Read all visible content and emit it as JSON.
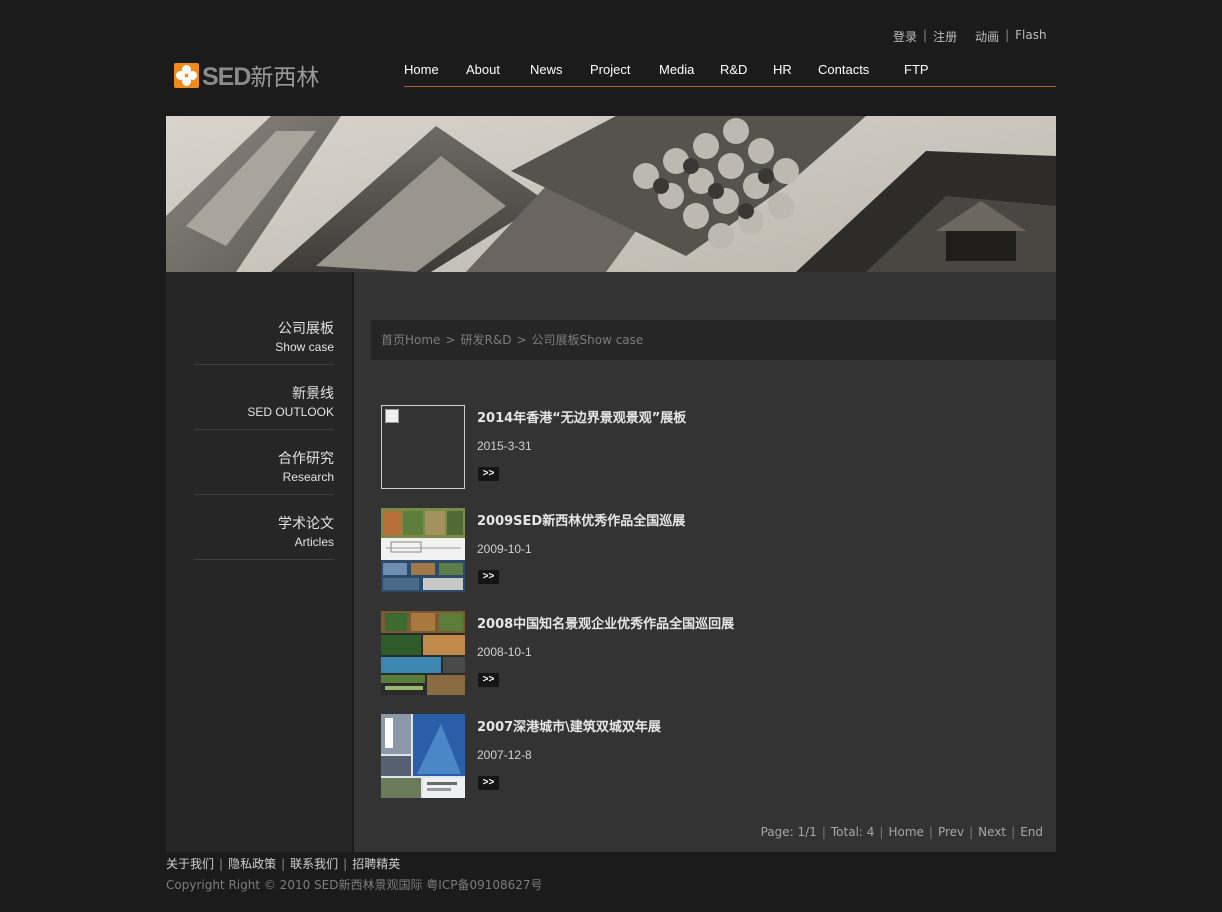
{
  "header": {
    "toplinks": {
      "login": "登录",
      "register": "注册",
      "animation": "动画",
      "flash": "Flash",
      "separator": "|"
    },
    "logo": {
      "latin": "SED",
      "cn": "新西林",
      "mark_color": "#f08a1c"
    },
    "nav": [
      {
        "label": "Home"
      },
      {
        "label": "About"
      },
      {
        "label": "News"
      },
      {
        "label": "Project"
      },
      {
        "label": "Media"
      },
      {
        "label": "R&D"
      },
      {
        "label": "HR"
      },
      {
        "label": "Contacts"
      },
      {
        "label": "FTP"
      }
    ],
    "nav_underline_color": "#b0672a"
  },
  "sidebar": {
    "items": [
      {
        "cn": "公司展板",
        "en": "Show case"
      },
      {
        "cn": "新景线",
        "en": "SED OUTLOOK"
      },
      {
        "cn": "合作研究",
        "en": "Research"
      },
      {
        "cn": "学术论文",
        "en": "Articles"
      }
    ]
  },
  "breadcrumb": {
    "items": [
      "首页Home",
      "研发R&D",
      "公司展板Show case"
    ],
    "separator": ">"
  },
  "list": [
    {
      "title": "2014年香港“无边界景观景观”展板",
      "date": "2015-3-31",
      "more": ">>",
      "thumb": "broken-image"
    },
    {
      "title": "2009SED新西林优秀作品全国巡展",
      "date": "2009-10-1",
      "more": ">>",
      "thumb": "exhibition-board"
    },
    {
      "title": "2008中国知名景观企业优秀作品全国巡回展",
      "date": "2008-10-1",
      "more": ">>",
      "thumb": "landscape-board"
    },
    {
      "title": "2007深港城市\\建筑双城双年展",
      "date": "2007-12-8",
      "more": ">>",
      "thumb": "building-board"
    }
  ],
  "pager": {
    "page": "Page: 1/1",
    "total": "Total: 4",
    "home": "Home",
    "prev": "Prev",
    "next": "Next",
    "end": "End",
    "separator": "|"
  },
  "footer": {
    "links": [
      "关于我们",
      "隐私政策",
      "联系我们",
      "招聘精英"
    ],
    "separator": "|",
    "copyright": "Copyright Right © 2010 SED新西林景观国际 粤ICP备09108627号"
  }
}
